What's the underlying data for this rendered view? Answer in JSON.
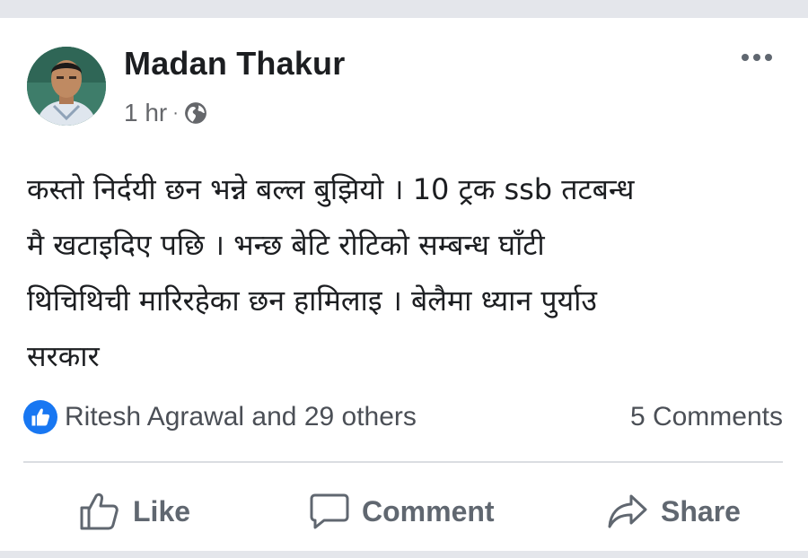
{
  "post": {
    "author": "Madan Thakur",
    "time": "1 hr",
    "separator": "·",
    "audience_icon": "globe-icon",
    "more_icon": "more-dots-icon",
    "text_lines": [
      "कस्तो निर्दयी छन भन्ने बल्ल बुझियो । 10 ट्रक ssb तटबन्ध",
      "मै खटाइदिए पछि । भन्छ बेटि रोटिको सम्बन्ध घाँटी",
      "थिचिथिची मारिरहेका छन हामिलाइ । बेलैमा ध्यान पुर्याउ",
      "सरकार"
    ]
  },
  "reactions": {
    "icon": "like-reaction-icon",
    "summary": "Ritesh Agrawal and 29 others",
    "comments": "5 Comments"
  },
  "actions": {
    "like": "Like",
    "comment": "Comment",
    "share": "Share"
  },
  "colors": {
    "page_background": "#e4e6eb",
    "card_background": "#ffffff",
    "like_blue": "#1877f2",
    "secondary_text": "#65676b"
  }
}
